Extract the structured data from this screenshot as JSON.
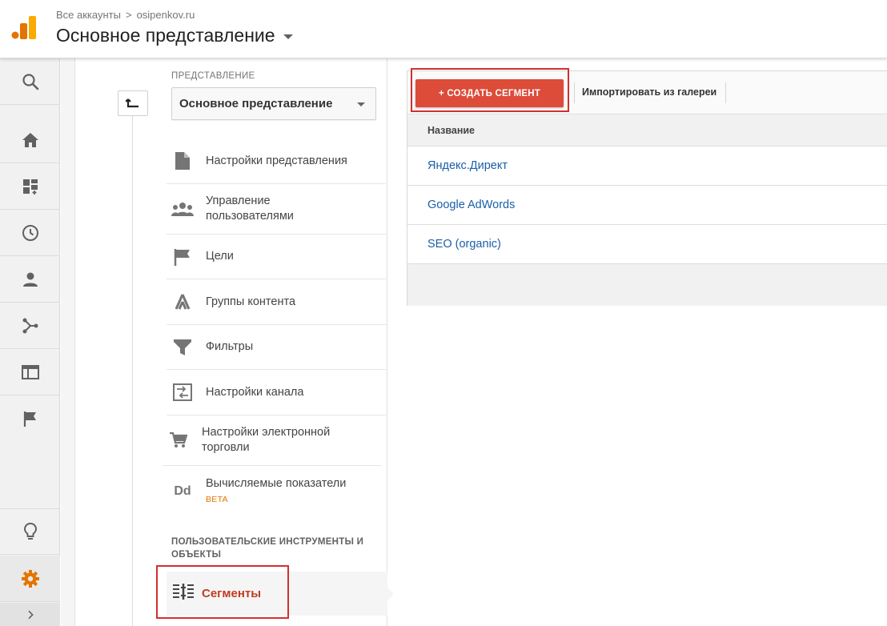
{
  "header": {
    "breadcrumb": [
      "Все аккаунты",
      "osipenkov.ru"
    ],
    "breadcrumb_sep": ">",
    "view_title": "Основное представление"
  },
  "rail": {
    "items": [
      "search-icon",
      "home-icon",
      "customization-icon",
      "clock-icon",
      "person-icon",
      "acquisition-icon",
      "behavior-icon",
      "flag-icon"
    ],
    "bottom_items": [
      "lightbulb-icon",
      "gear-icon",
      "expand-chevron-icon"
    ],
    "accent": "#e37400"
  },
  "admin": {
    "section_label": "ПРЕДСТАВЛЕНИЕ",
    "selected_view": "Основное представление",
    "menu": [
      {
        "label": "Настройки представления",
        "icon": "document-icon"
      },
      {
        "label": "Управление пользователями",
        "icon": "users-icon"
      },
      {
        "label": "Цели",
        "icon": "flag-icon"
      },
      {
        "label": "Группы контента",
        "icon": "content-groups-icon"
      },
      {
        "label": "Фильтры",
        "icon": "filter-icon"
      },
      {
        "label": "Настройки канала",
        "icon": "channel-settings-icon"
      },
      {
        "label": "Настройки электронной торговли",
        "icon": "cart-icon"
      },
      {
        "label": "Вычисляемые показатели",
        "icon": "dd-icon",
        "badge": "BETA"
      }
    ],
    "section2_label": "ПОЛЬЗОВАТЕЛЬСКИЕ ИНСТРУМЕНТЫ И ОБЪЕКТЫ",
    "active_item": "Сегменты",
    "dd_text": "Dd"
  },
  "segments": {
    "create_label": "+ СОЗДАТЬ СЕГМЕНТ",
    "import_label": "Импортировать из галереи",
    "column_header": "Название",
    "rows": [
      "Яндекс.Директ",
      "Google AdWords",
      "SEO (organic)"
    ],
    "link_color": "#1a5fa8",
    "button_color": "#dd4b39",
    "highlight_color": "#d32f2f"
  }
}
